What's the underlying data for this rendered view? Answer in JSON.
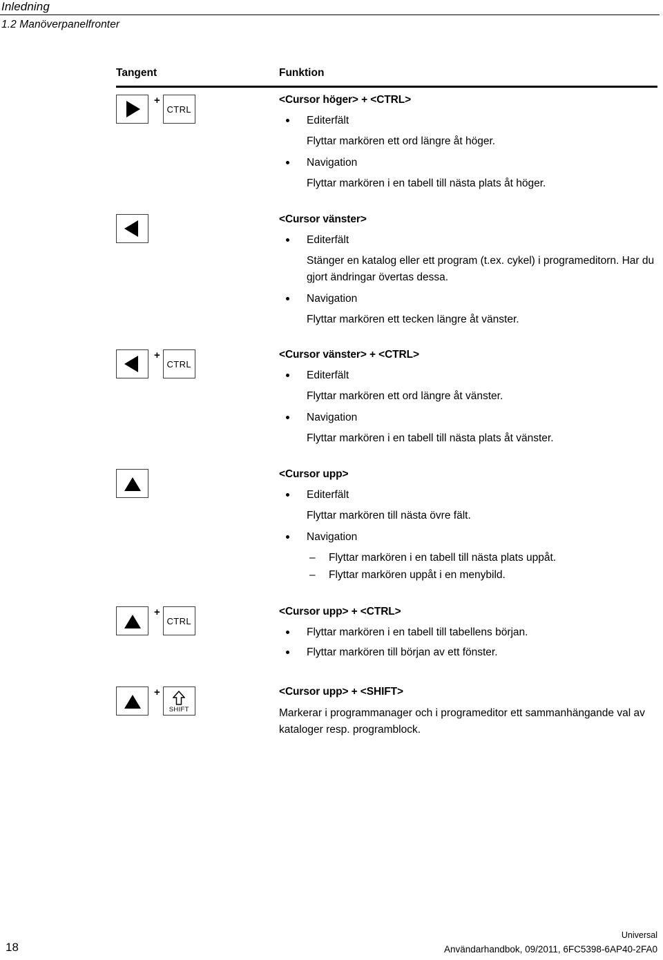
{
  "header": {
    "chapter": "Inledning",
    "section": "1.2 Manöverpanelfronter"
  },
  "table": {
    "col_key_header": "Tangent",
    "col_function_header": "Funktion",
    "rows": [
      {
        "keys": [
          {
            "type": "arrow-right",
            "icon": "cursor-right-arrow-icon"
          },
          {
            "type": "label",
            "label": "CTRL"
          }
        ],
        "combiner": "+",
        "title": "<Cursor höger> + <CTRL>",
        "blocks": [
          {
            "kind": "bullet",
            "text": "Editerfält"
          },
          {
            "kind": "para",
            "text": "Flyttar markören ett ord längre åt höger."
          },
          {
            "kind": "bullet",
            "text": "Navigation"
          },
          {
            "kind": "para",
            "text": "Flyttar markören i en tabell till nästa plats åt höger."
          }
        ]
      },
      {
        "keys": [
          {
            "type": "arrow-left",
            "icon": "cursor-left-arrow-icon"
          }
        ],
        "combiner": "",
        "title": "<Cursor vänster>",
        "blocks": [
          {
            "kind": "bullet",
            "text": "Editerfält"
          },
          {
            "kind": "para",
            "text": "Stänger en katalog eller ett program (t.ex. cykel) i programeditorn. Har du gjort ändringar övertas dessa."
          },
          {
            "kind": "bullet",
            "text": "Navigation"
          },
          {
            "kind": "para",
            "text": "Flyttar markören ett tecken längre åt vänster."
          }
        ]
      },
      {
        "keys": [
          {
            "type": "arrow-left",
            "icon": "cursor-left-arrow-icon"
          },
          {
            "type": "label",
            "label": "CTRL"
          }
        ],
        "combiner": "+",
        "title": "<Cursor vänster> + <CTRL>",
        "blocks": [
          {
            "kind": "bullet",
            "text": "Editerfält"
          },
          {
            "kind": "para",
            "text": "Flyttar markören ett ord längre åt vänster."
          },
          {
            "kind": "bullet",
            "text": "Navigation"
          },
          {
            "kind": "para",
            "text": "Flyttar markören i en tabell till nästa plats åt vänster."
          }
        ]
      },
      {
        "keys": [
          {
            "type": "arrow-up",
            "icon": "cursor-up-arrow-icon"
          }
        ],
        "combiner": "",
        "title": "<Cursor upp>",
        "blocks": [
          {
            "kind": "bullet",
            "text": "Editerfält"
          },
          {
            "kind": "para",
            "text": "Flyttar markören till nästa övre fält."
          },
          {
            "kind": "bullet",
            "text": "Navigation"
          },
          {
            "kind": "dash",
            "text": "Flyttar markören i en tabell till nästa plats uppåt."
          },
          {
            "kind": "dash",
            "text": "Flyttar markören uppåt i en menybild."
          }
        ]
      },
      {
        "keys": [
          {
            "type": "arrow-up",
            "icon": "cursor-up-arrow-icon"
          },
          {
            "type": "label",
            "label": "CTRL"
          }
        ],
        "combiner": "+",
        "title": "<Cursor upp> + <CTRL>",
        "blocks": [
          {
            "kind": "bullet",
            "text": "Flyttar markören i en tabell till tabellens början."
          },
          {
            "kind": "bullet",
            "text": "Flyttar markören till början av ett fönster."
          }
        ]
      },
      {
        "keys": [
          {
            "type": "arrow-up",
            "icon": "cursor-up-arrow-icon"
          },
          {
            "type": "shift",
            "label": "SHIFT",
            "icon": "shift-arrow-icon"
          }
        ],
        "combiner": "+",
        "title": "<Cursor upp> + <SHIFT>",
        "blocks": [
          {
            "kind": "plain",
            "text": "Markerar i programmanager och i programeditor ett sammanhängande val av kataloger resp. programblock."
          }
        ]
      }
    ]
  },
  "footer": {
    "page_number": "18",
    "product": "Universal",
    "document": "Användarhandbok, 09/2011, 6FC5398-6AP40-2FA0"
  }
}
